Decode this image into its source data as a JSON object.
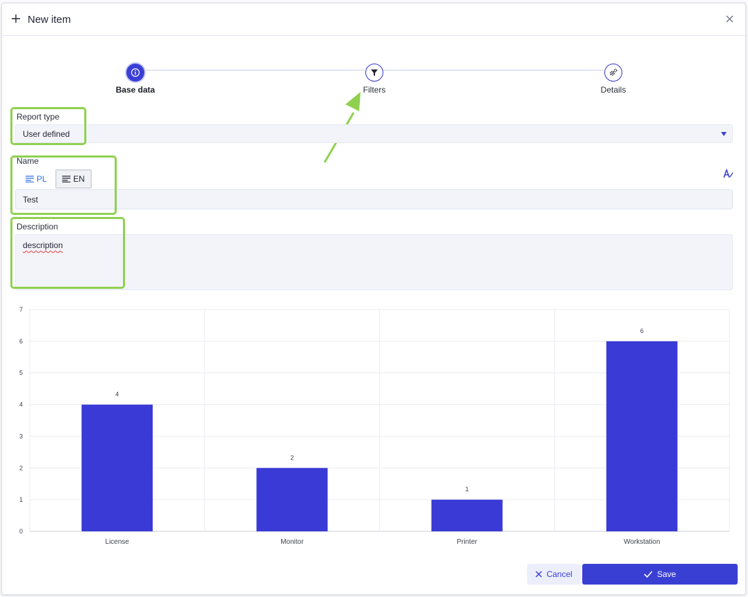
{
  "dialog": {
    "title": "New item"
  },
  "steps": [
    {
      "label": "Base data",
      "icon": "info-icon",
      "active": true
    },
    {
      "label": "Filters",
      "icon": "filter-icon",
      "active": false
    },
    {
      "label": "Details",
      "icon": "gears-icon",
      "active": false
    }
  ],
  "form": {
    "report_type_label": "Report type",
    "report_type_value": "User defined",
    "name_label": "Name",
    "lang_tabs": [
      "PL",
      "EN"
    ],
    "name_value": "Test",
    "description_label": "Description",
    "description_value": "description"
  },
  "chart_data": {
    "type": "bar",
    "categories": [
      "License",
      "Monitor",
      "Printer",
      "Workstation"
    ],
    "values": [
      4,
      2,
      1,
      6
    ],
    "data_labels": [
      "4",
      "2",
      "1",
      "6"
    ],
    "ylim": [
      0,
      7
    ],
    "yticks": [
      "0",
      "1",
      "2",
      "3",
      "4",
      "5",
      "6",
      "7"
    ],
    "grid": true,
    "bar_color": "#3a3ad6"
  },
  "actions": {
    "cancel_label": "Cancel",
    "save_label": "Save"
  },
  "colors": {
    "accent": "#3a3fd4",
    "highlight": "#8fd14f"
  }
}
